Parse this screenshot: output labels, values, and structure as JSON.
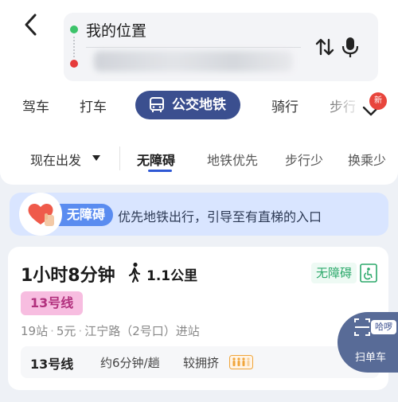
{
  "header": {
    "from_label": "我的位置",
    "to_label": "",
    "colors": {
      "start_dot": "#3cc36a",
      "end_dot": "#e63b3b"
    },
    "icons": {
      "back": "chevron-left-icon",
      "swap": "swap-icon",
      "mic": "mic-icon"
    }
  },
  "mode_tabs": {
    "items": [
      "驾车",
      "打车",
      "公交地铁",
      "骑行",
      "步行"
    ],
    "active": "公交地铁",
    "new_badge": "新",
    "accent": "#3b4f8f"
  },
  "filters": {
    "depart_label": "现在出发",
    "options": [
      "无障碍",
      "地铁优先",
      "步行少",
      "换乘少"
    ],
    "active": "无障碍",
    "underline_color": "#2e58d4"
  },
  "banner": {
    "tag": "无障碍",
    "text": "优先地铁出行，引导至有直梯的入口",
    "colors": {
      "background": "#d9e5ff",
      "tag": "#5a8cf0"
    }
  },
  "route": {
    "duration": "1小时8分钟",
    "walk_distance": "1.1公里",
    "accessibility_badge": "无障碍",
    "line_tag": "13号线",
    "stations": "19站",
    "fare": "5元",
    "entrance": "江宁路（2号口）进站",
    "segment": {
      "line": "13号线",
      "frequency": "约6分钟/趟",
      "crowd": "较拥挤"
    },
    "colors": {
      "line_tag_bg": "#f7bde0",
      "line_tag_text": "#b2317e",
      "accessible": "#2ba86a"
    }
  },
  "fab": {
    "badge": "哈啰",
    "label": "扫单车",
    "icon": "scan-icon"
  }
}
